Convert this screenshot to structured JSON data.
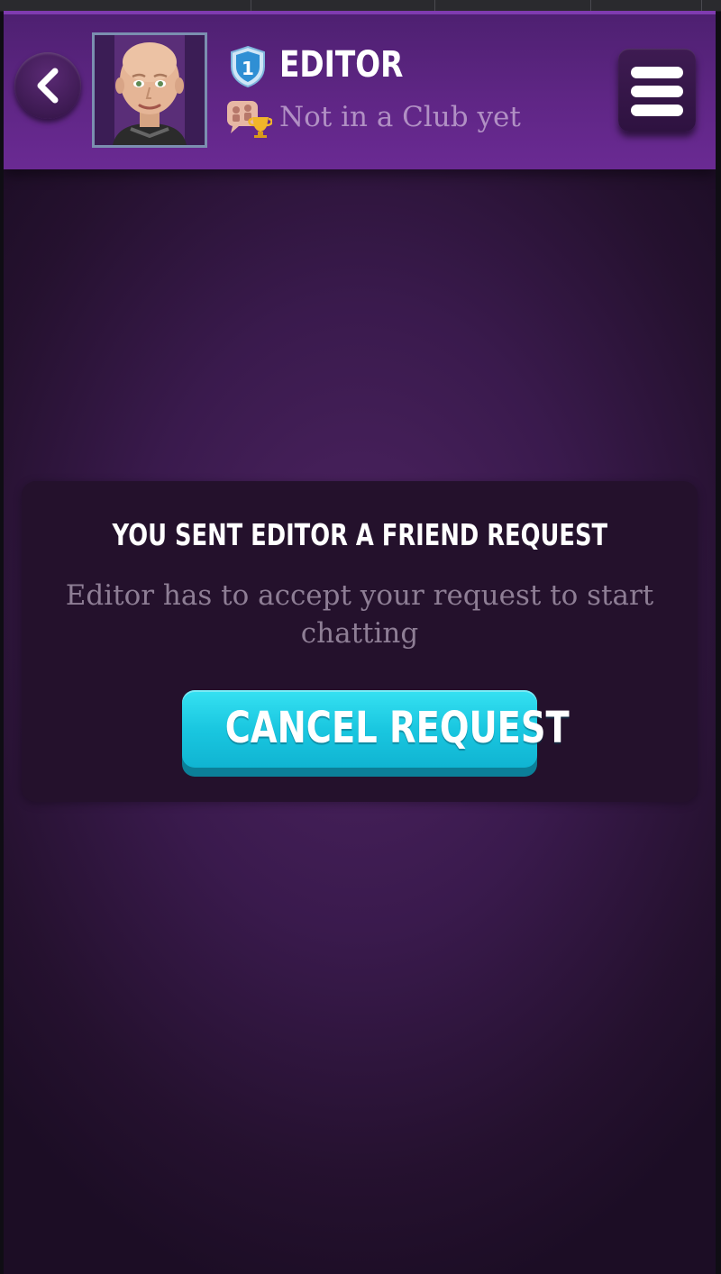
{
  "header": {
    "player_name": "EDITOR",
    "rank_level": "1",
    "club_status": "Not in a Club yet",
    "back_icon": "chevron-left-icon",
    "menu_icon": "hamburger-menu-icon",
    "avatar_icon": "player-avatar"
  },
  "friend_request": {
    "title": "YOU SENT EDITOR A FRIEND REQUEST",
    "message": "Editor has to accept your request to start chatting",
    "cancel_label": "CANCEL REQUEST"
  },
  "colors": {
    "header_purple": "#5f2685",
    "background_purple": "#3a1a4d",
    "card_background": "#24112c",
    "button_cyan": "#1ac7e0",
    "muted_text": "#8e7e95",
    "club_text": "#b190c4"
  }
}
